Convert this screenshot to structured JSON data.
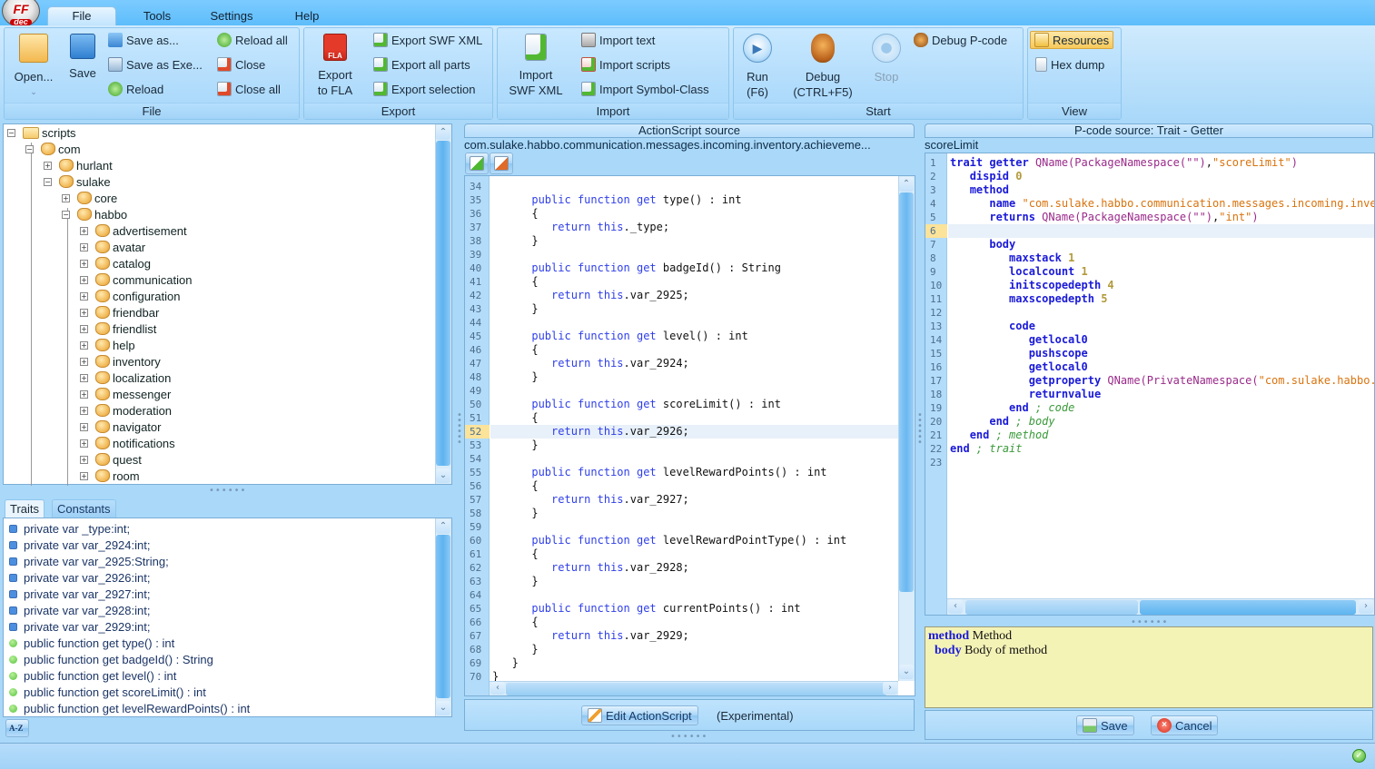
{
  "app": {
    "logo_top": "FF",
    "logo_bottom": "dec"
  },
  "menu": {
    "tabs": [
      {
        "label": "File",
        "active": true
      },
      {
        "label": "Tools"
      },
      {
        "label": "Settings"
      },
      {
        "label": "Help"
      }
    ]
  },
  "ribbon": {
    "file": {
      "group_label": "File",
      "open": "Open...",
      "save": "Save",
      "save_as": "Save as...",
      "save_as_exe": "Save as Exe...",
      "reload": "Reload",
      "reload_all": "Reload all",
      "close": "Close",
      "close_all": "Close all"
    },
    "export": {
      "group_label": "Export",
      "export_to_fla_1": "Export",
      "export_to_fla_2": "to FLA",
      "fla_badge": "FLA",
      "export_swf_xml": "Export SWF XML",
      "export_all_parts": "Export all parts",
      "export_selection": "Export selection"
    },
    "import": {
      "group_label": "Import",
      "import_swf_xml_1": "Import",
      "import_swf_xml_2": "SWF XML",
      "import_text": "Import text",
      "import_scripts": "Import scripts",
      "import_symbol_class": "Import Symbol-Class"
    },
    "start": {
      "group_label": "Start",
      "run_1": "Run",
      "run_2": "(F6)",
      "debug_1": "Debug",
      "debug_2": "(CTRL+F5)",
      "stop": "Stop",
      "debug_pcode": "Debug P-code"
    },
    "view": {
      "group_label": "View",
      "resources": "Resources",
      "hex_dump": "Hex dump"
    }
  },
  "tree": {
    "nodes": [
      {
        "label": "scripts",
        "level": 0,
        "expanded": true,
        "type": "folder"
      },
      {
        "label": "com",
        "level": 1,
        "expanded": true
      },
      {
        "label": "hurlant",
        "level": 2,
        "expanded": false
      },
      {
        "label": "sulake",
        "level": 2,
        "expanded": true
      },
      {
        "label": "core",
        "level": 3,
        "expanded": false
      },
      {
        "label": "habbo",
        "level": 3,
        "expanded": true
      },
      {
        "label": "advertisement",
        "level": 4,
        "expanded": false
      },
      {
        "label": "avatar",
        "level": 4,
        "expanded": false
      },
      {
        "label": "catalog",
        "level": 4,
        "expanded": false
      },
      {
        "label": "communication",
        "level": 4,
        "expanded": false
      },
      {
        "label": "configuration",
        "level": 4,
        "expanded": false
      },
      {
        "label": "friendbar",
        "level": 4,
        "expanded": false
      },
      {
        "label": "friendlist",
        "level": 4,
        "expanded": false
      },
      {
        "label": "help",
        "level": 4,
        "expanded": false
      },
      {
        "label": "inventory",
        "level": 4,
        "expanded": false
      },
      {
        "label": "localization",
        "level": 4,
        "expanded": false
      },
      {
        "label": "messenger",
        "level": 4,
        "expanded": false
      },
      {
        "label": "moderation",
        "level": 4,
        "expanded": false
      },
      {
        "label": "navigator",
        "level": 4,
        "expanded": false
      },
      {
        "label": "notifications",
        "level": 4,
        "expanded": false
      },
      {
        "label": "quest",
        "level": 4,
        "expanded": false
      },
      {
        "label": "room",
        "level": 4,
        "expanded": false
      }
    ]
  },
  "traits_panel": {
    "tabs": [
      {
        "label": "Traits",
        "active": true
      },
      {
        "label": "Constants"
      }
    ],
    "items": [
      {
        "kind": "var",
        "text": "private var _type:int;"
      },
      {
        "kind": "var",
        "text": "private var var_2924:int;"
      },
      {
        "kind": "var",
        "text": "private var var_2925:String;"
      },
      {
        "kind": "var",
        "text": "private var var_2926:int;"
      },
      {
        "kind": "var",
        "text": "private var var_2927:int;"
      },
      {
        "kind": "var",
        "text": "private var var_2928:int;"
      },
      {
        "kind": "var",
        "text": "private var var_2929:int;"
      },
      {
        "kind": "fn",
        "text": "public function get type() : int"
      },
      {
        "kind": "fn",
        "text": "public function get badgeId() : String"
      },
      {
        "kind": "fn",
        "text": "public function get level() : int"
      },
      {
        "kind": "fn",
        "text": "public function get scoreLimit() : int"
      },
      {
        "kind": "fn",
        "text": "public function get levelRewardPoints() : int"
      }
    ],
    "sort_button": "A-Z"
  },
  "actionscript": {
    "title": "ActionScript source",
    "class_path": "com.sulake.habbo.communication.messages.incoming.inventory.achieveme...",
    "highlighted_line": 52,
    "lines": [
      {
        "n": 34,
        "code": ""
      },
      {
        "n": 35,
        "getter": "type",
        "ret": "int"
      },
      {
        "n": 36,
        "code": "      {"
      },
      {
        "n": 37,
        "ret_var": "_type"
      },
      {
        "n": 38,
        "code": "      }"
      },
      {
        "n": 39,
        "code": ""
      },
      {
        "n": 40,
        "getter": "badgeId",
        "ret": "String"
      },
      {
        "n": 41,
        "code": "      {"
      },
      {
        "n": 42,
        "ret_var": "var_2925"
      },
      {
        "n": 43,
        "code": "      }"
      },
      {
        "n": 44,
        "code": ""
      },
      {
        "n": 45,
        "getter": "level",
        "ret": "int"
      },
      {
        "n": 46,
        "code": "      {"
      },
      {
        "n": 47,
        "ret_var": "var_2924"
      },
      {
        "n": 48,
        "code": "      }"
      },
      {
        "n": 49,
        "code": ""
      },
      {
        "n": 50,
        "getter": "scoreLimit",
        "ret": "int"
      },
      {
        "n": 51,
        "code": "      {"
      },
      {
        "n": 52,
        "ret_var": "var_2926"
      },
      {
        "n": 53,
        "code": "      }"
      },
      {
        "n": 54,
        "code": ""
      },
      {
        "n": 55,
        "getter": "levelRewardPoints",
        "ret": "int"
      },
      {
        "n": 56,
        "code": "      {"
      },
      {
        "n": 57,
        "ret_var": "var_2927"
      },
      {
        "n": 58,
        "code": "      }"
      },
      {
        "n": 59,
        "code": ""
      },
      {
        "n": 60,
        "getter": "levelRewardPointType",
        "ret": "int"
      },
      {
        "n": 61,
        "code": "      {"
      },
      {
        "n": 62,
        "ret_var": "var_2928"
      },
      {
        "n": 63,
        "code": "      }"
      },
      {
        "n": 64,
        "code": ""
      },
      {
        "n": 65,
        "getter": "currentPoints",
        "ret": "int"
      },
      {
        "n": 66,
        "code": "      {"
      },
      {
        "n": 67,
        "ret_var": "var_2929"
      },
      {
        "n": 68,
        "code": "      }"
      },
      {
        "n": 69,
        "code": "   }"
      },
      {
        "n": 70,
        "code": "}"
      }
    ],
    "kw_public": "public",
    "kw_function": "function",
    "kw_get": "get",
    "kw_return": "return",
    "kw_this": "this",
    "edit_button": "Edit ActionScript",
    "experimental": "(Experimental)"
  },
  "pcode": {
    "title": "P-code source: Trait - Getter",
    "trait_name": "scoreLimit",
    "highlighted_line": 6,
    "lines": [
      {
        "n": 1,
        "html": "<span class='kwb'>trait getter</span> <span class='qn'>QName(PackageNamespace(\"\")</span>,<span class='str'>\"scoreLimit\"</span><span class='qn'>)</span>"
      },
      {
        "n": 2,
        "html": "   <span class='kwb'>dispid</span> <span class='num'>0</span>"
      },
      {
        "n": 3,
        "html": "   <span class='kwb'>method</span>"
      },
      {
        "n": 4,
        "html": "      <span class='kwb'>name</span> <span class='str'>\"com.sulake.habbo.communication.messages.incoming.invent</span>"
      },
      {
        "n": 5,
        "html": "      <span class='kwb'>returns</span> <span class='qn'>QName(PackageNamespace(\"\")</span>,<span class='str'>\"int\"</span><span class='qn'>)</span>"
      },
      {
        "n": 6,
        "html": ""
      },
      {
        "n": 7,
        "html": "      <span class='kwb'>body</span>"
      },
      {
        "n": 8,
        "html": "         <span class='kwb'>maxstack</span> <span class='num'>1</span>"
      },
      {
        "n": 9,
        "html": "         <span class='kwb'>localcount</span> <span class='num'>1</span>"
      },
      {
        "n": 10,
        "html": "         <span class='kwb'>initscopedepth</span> <span class='num'>4</span>"
      },
      {
        "n": 11,
        "html": "         <span class='kwb'>maxscopedepth</span> <span class='num'>5</span>"
      },
      {
        "n": 12,
        "html": ""
      },
      {
        "n": 13,
        "html": "         <span class='kwb'>code</span>"
      },
      {
        "n": 14,
        "html": "            <span class='kwb'>getlocal0</span>"
      },
      {
        "n": 15,
        "html": "            <span class='kwb'>pushscope</span>"
      },
      {
        "n": 16,
        "html": "            <span class='kwb'>getlocal0</span>"
      },
      {
        "n": 17,
        "html": "            <span class='kwb'>getproperty</span> <span class='qn'>QName(PrivateNamespace(</span><span class='str'>\"com.sulake.habbo.co</span>"
      },
      {
        "n": 18,
        "html": "            <span class='kwb'>returnvalue</span>"
      },
      {
        "n": 19,
        "html": "         <span class='kwb'>end</span> <span class='cm'>; code</span>"
      },
      {
        "n": 20,
        "html": "      <span class='kwb'>end</span> <span class='cm'>; body</span>"
      },
      {
        "n": 21,
        "html": "   <span class='kwb'>end</span> <span class='cm'>; method</span>"
      },
      {
        "n": 22,
        "html": "<span class='kwb'>end</span> <span class='cm'>; trait</span>"
      },
      {
        "n": 23,
        "html": ""
      }
    ],
    "doc": {
      "line1_kw": "method",
      "line1_text": "Method",
      "line2_kw": "body",
      "line2_text": "Body of method"
    },
    "save_button": "Save",
    "cancel_button": "Cancel"
  },
  "status": {
    "icon": "ok-check-icon"
  },
  "colors": {
    "accent": "#5dbdfb",
    "panel_bg": "#a9d8f9",
    "keyword": "#2f3fe8",
    "string": "#d9730d",
    "highlight_line": "#fbe39a"
  }
}
